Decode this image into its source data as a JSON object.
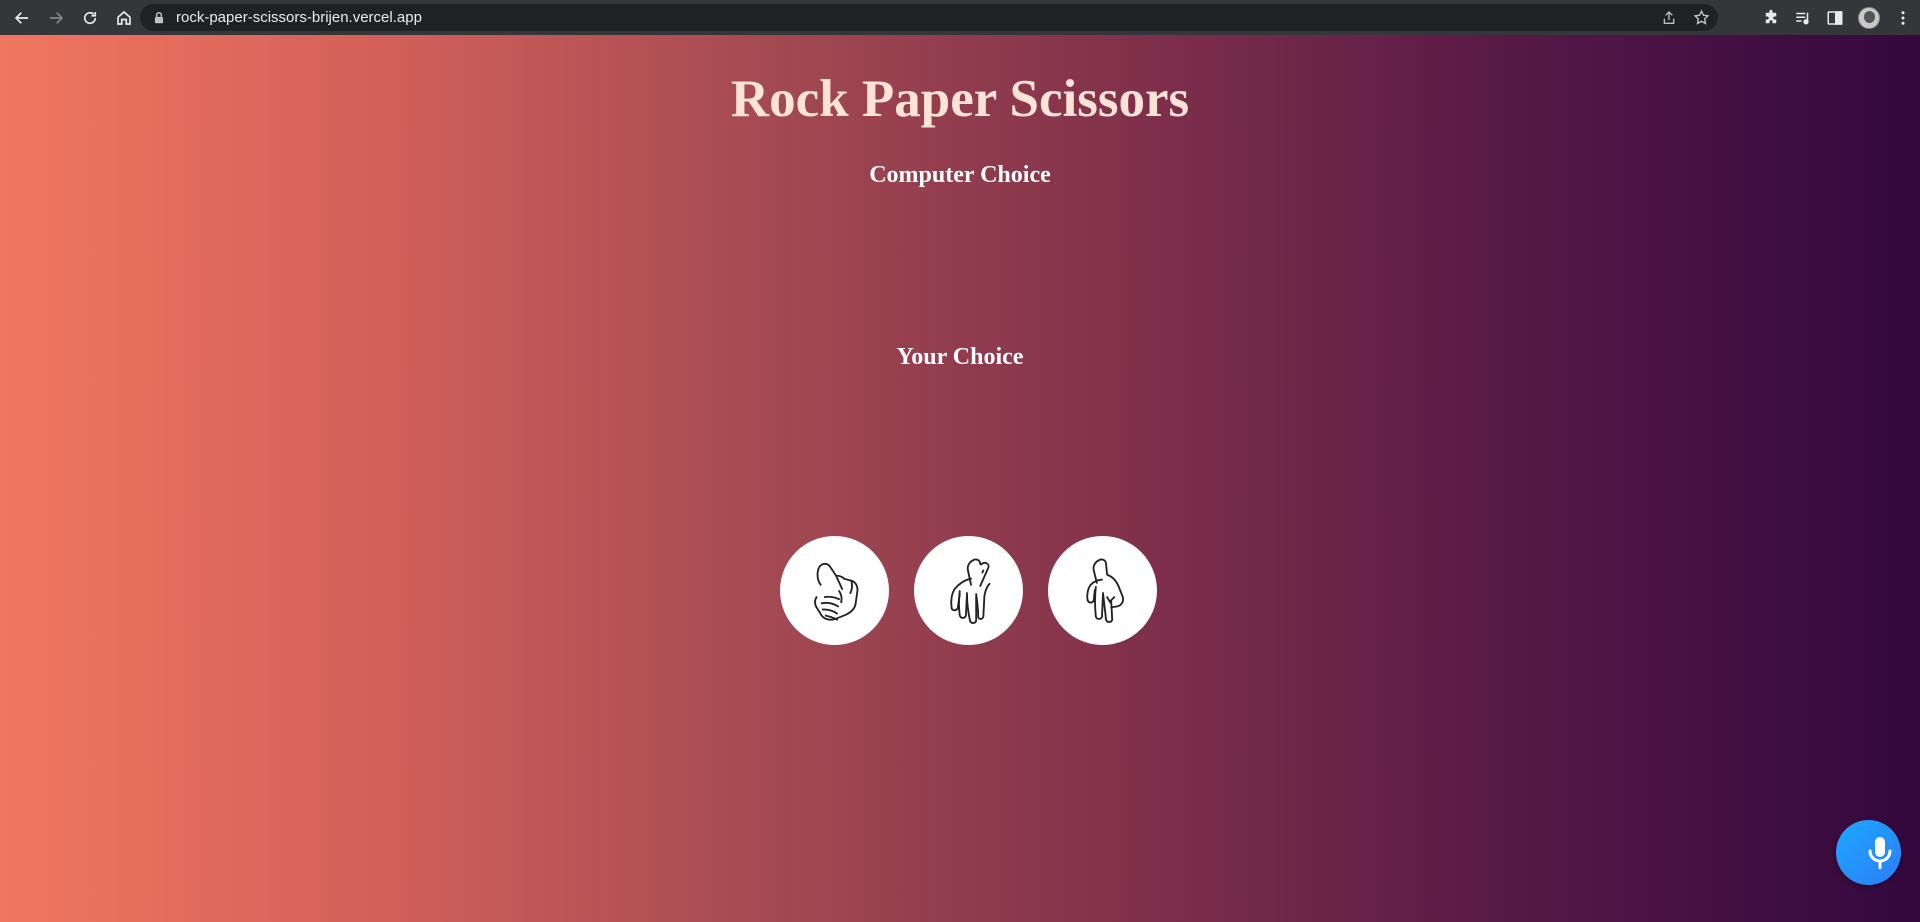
{
  "browser": {
    "url": "rock-paper-scissors-brijen.vercel.app",
    "icons": [
      "back-icon",
      "forward-icon",
      "reload-icon",
      "home-icon",
      "lock-icon",
      "share-icon",
      "star-icon",
      "extensions-icon",
      "media-icon",
      "sidebar-icon",
      "profile-avatar",
      "menu-icon"
    ]
  },
  "game": {
    "title": "Rock Paper Scissors",
    "computer_choice_label": "Computer Choice",
    "your_choice_label": "Your Choice",
    "choices": [
      "rock",
      "paper",
      "scissors"
    ]
  },
  "colors": {
    "gradient_start": "#f1765f",
    "gradient_end": "#33083e",
    "title_color": "#fbe4d6",
    "mic_button": "#1aa9ff"
  }
}
